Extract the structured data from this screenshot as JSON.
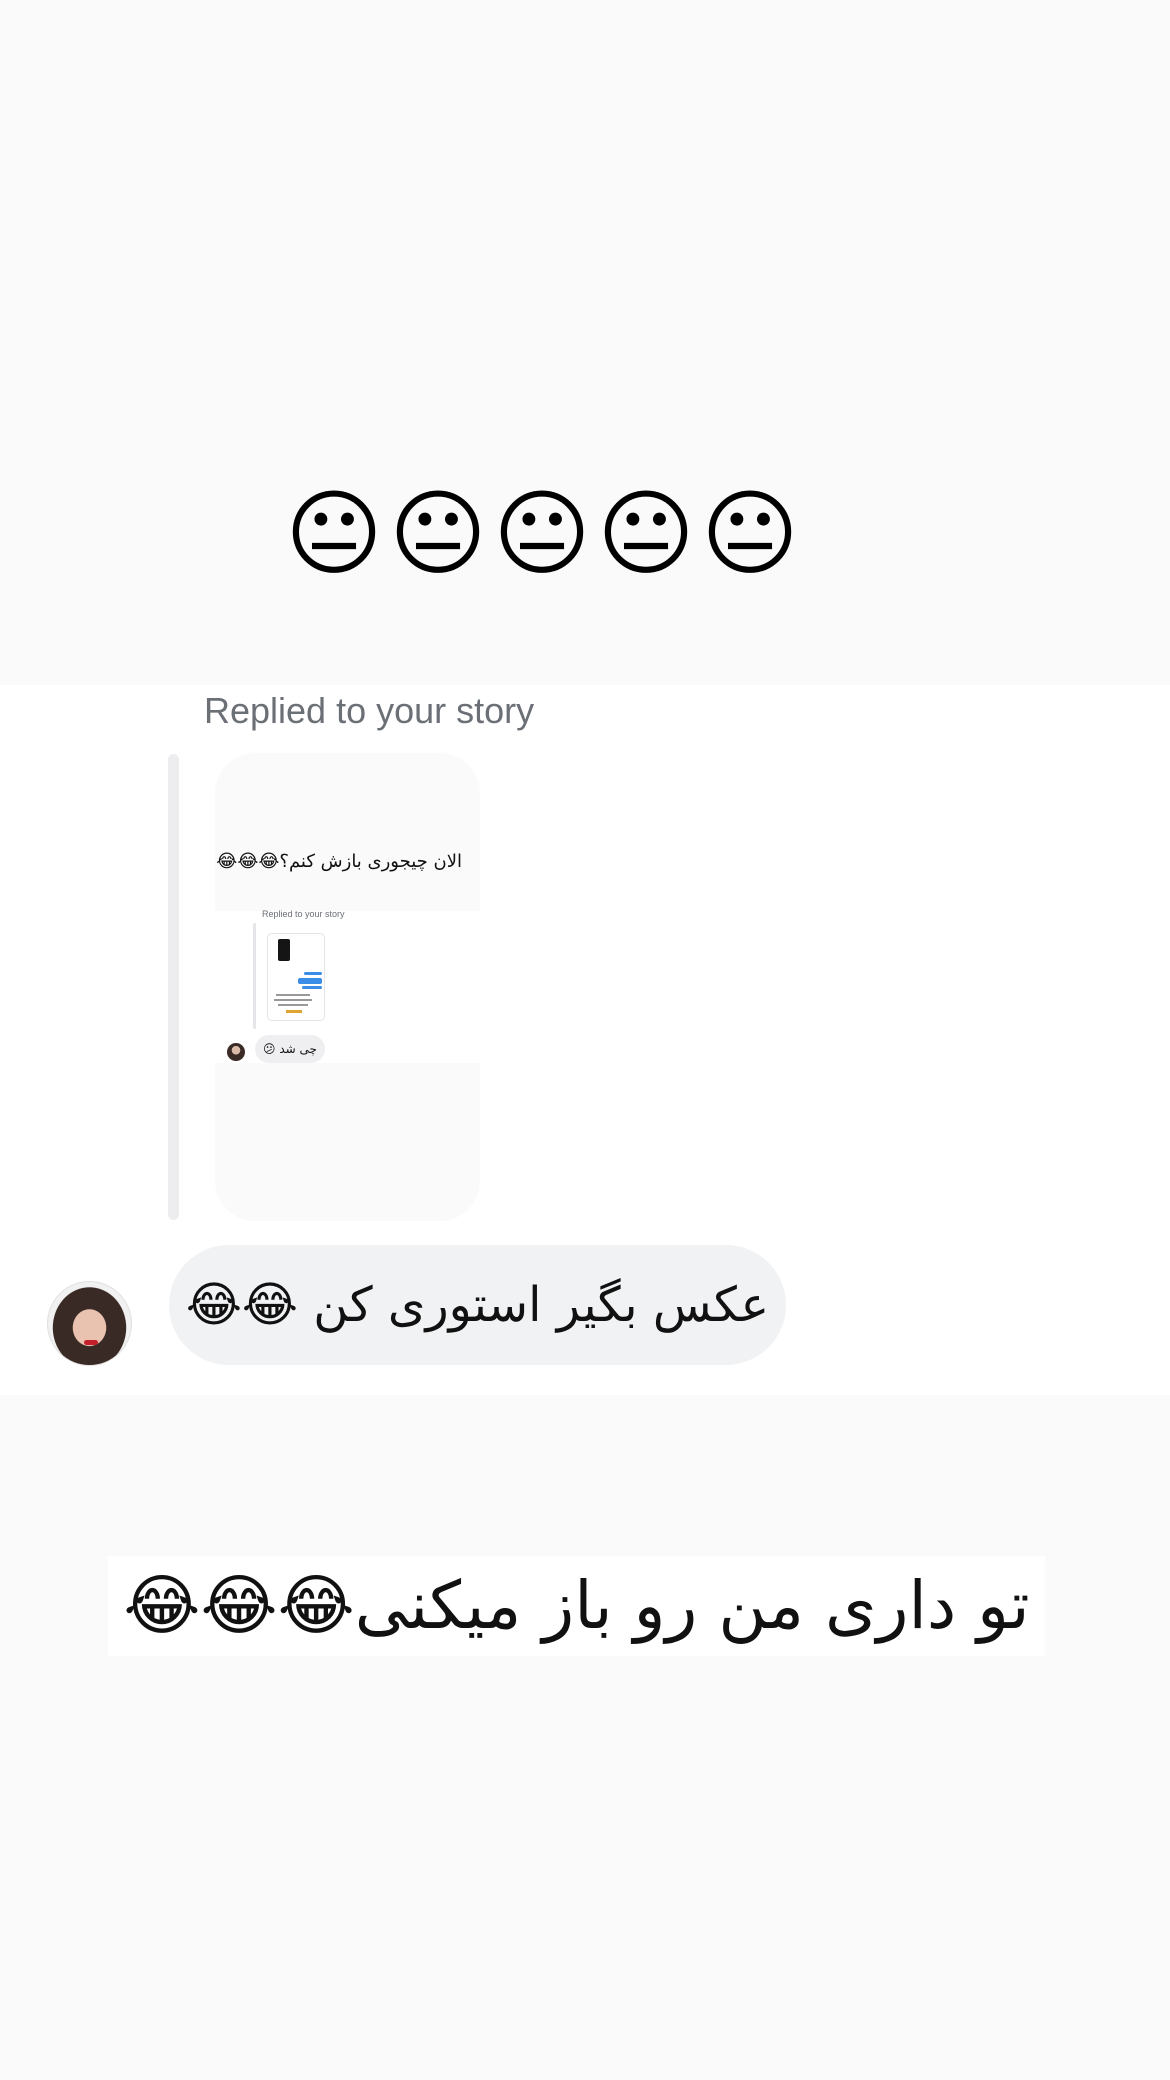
{
  "story_top": {
    "emojis": "😐😐😐😐😐"
  },
  "reply": {
    "label": "Replied to your story",
    "story_caption": "الان چیجوری بازش کنم؟😂😂😂",
    "nested": {
      "label": "Replied to your story",
      "bubble_text": "چی شد 😕"
    }
  },
  "message": {
    "text": "عکس بگیر استوری کن 😂😂"
  },
  "story_bottom": {
    "caption": "تو داری من رو باز میکنی😂😂😂"
  }
}
